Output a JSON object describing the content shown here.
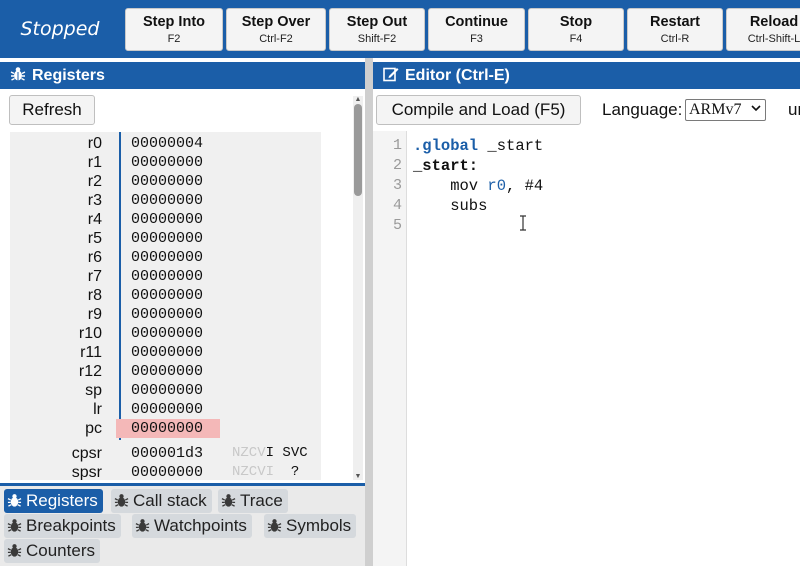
{
  "toolbar": {
    "status": "Stopped",
    "buttons": [
      {
        "label": "Step Into",
        "key": "F2"
      },
      {
        "label": "Step Over",
        "key": "Ctrl-F2"
      },
      {
        "label": "Step Out",
        "key": "Shift-F2"
      },
      {
        "label": "Continue",
        "key": "F3"
      },
      {
        "label": "Stop",
        "key": "F4"
      },
      {
        "label": "Restart",
        "key": "Ctrl-R"
      },
      {
        "label": "Reload",
        "key": "Ctrl-Shift-L"
      }
    ]
  },
  "registers_panel": {
    "title": "Registers",
    "refresh_label": "Refresh",
    "registers": [
      {
        "name": "r0",
        "value": "00000004"
      },
      {
        "name": "r1",
        "value": "00000000"
      },
      {
        "name": "r2",
        "value": "00000000"
      },
      {
        "name": "r3",
        "value": "00000000"
      },
      {
        "name": "r4",
        "value": "00000000"
      },
      {
        "name": "r5",
        "value": "00000000"
      },
      {
        "name": "r6",
        "value": "00000000"
      },
      {
        "name": "r7",
        "value": "00000000"
      },
      {
        "name": "r8",
        "value": "00000000"
      },
      {
        "name": "r9",
        "value": "00000000"
      },
      {
        "name": "r10",
        "value": "00000000"
      },
      {
        "name": "r11",
        "value": "00000000"
      },
      {
        "name": "r12",
        "value": "00000000"
      },
      {
        "name": "sp",
        "value": "00000000"
      },
      {
        "name": "lr",
        "value": "00000000"
      },
      {
        "name": "pc",
        "value": "00000000",
        "highlighted": true
      }
    ],
    "status_registers": [
      {
        "name": "cpsr",
        "value": "000001d3",
        "flags": "NZCV",
        "flag_i": "I",
        "mode": "SVC"
      },
      {
        "name": "spsr",
        "value": "00000000",
        "flags": "NZCVI",
        "flag_i": "",
        "mode": "?"
      }
    ],
    "highlight_color": "#f4b8b8"
  },
  "tabs": [
    {
      "label": "Registers",
      "active": true
    },
    {
      "label": "Call stack",
      "active": false
    },
    {
      "label": "Trace",
      "active": false
    },
    {
      "label": "Breakpoints",
      "active": false
    },
    {
      "label": "Watchpoints",
      "active": false
    },
    {
      "label": "Symbols",
      "active": false
    },
    {
      "label": "Counters",
      "active": false
    }
  ],
  "editor": {
    "title": "Editor (Ctrl-E)",
    "compile_label": "Compile and Load (F5)",
    "language_label": "Language:",
    "language_value": "ARMv7",
    "truncated_text": "ur",
    "line_numbers": [
      "1",
      "2",
      "3",
      "4",
      "5"
    ],
    "code": {
      "line1_directive": ".global",
      "line1_rest": " _start",
      "line2_label": "_start:",
      "line3_indent": "    mov ",
      "line3_reg": "r0",
      "line3_rest": ", #4",
      "line4": "    subs"
    }
  },
  "colors": {
    "brand_blue": "#1b5ea8",
    "register_highlight": "#f4b8b8"
  },
  "icons": {
    "registers_header": "bug-icon",
    "editor_header": "edit-icon",
    "tabs": "bug-icon"
  }
}
